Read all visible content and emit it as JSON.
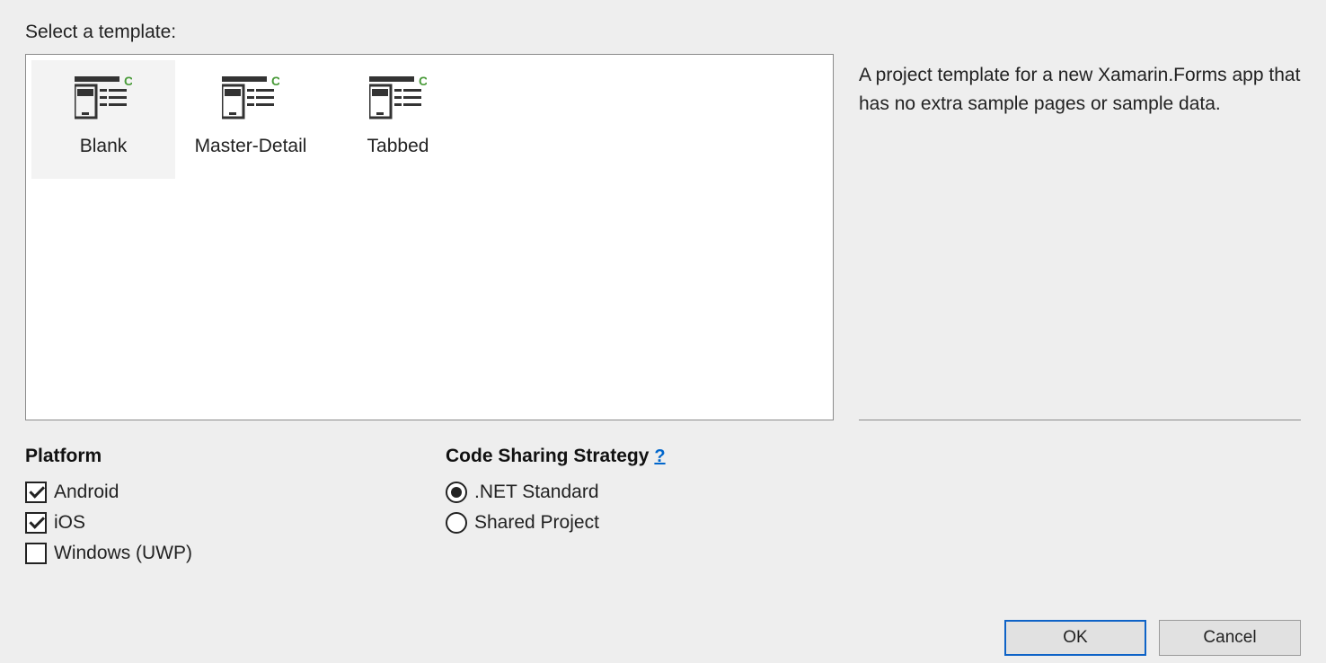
{
  "header": {
    "label": "Select a template:"
  },
  "templates": {
    "items": [
      {
        "label": "Blank",
        "selected": true
      },
      {
        "label": "Master-Detail",
        "selected": false
      },
      {
        "label": "Tabbed",
        "selected": false
      }
    ]
  },
  "description": {
    "text": "A project template for a new Xamarin.Forms app that has no extra sample pages or sample data."
  },
  "platform": {
    "title": "Platform",
    "options": [
      {
        "label": "Android",
        "checked": true
      },
      {
        "label": "iOS",
        "checked": true
      },
      {
        "label": "Windows (UWP)",
        "checked": false
      }
    ]
  },
  "code_sharing": {
    "title": "Code Sharing Strategy",
    "help": "?",
    "options": [
      {
        "label": ".NET Standard",
        "selected": true
      },
      {
        "label": "Shared Project",
        "selected": false
      }
    ]
  },
  "buttons": {
    "ok": "OK",
    "cancel": "Cancel"
  }
}
